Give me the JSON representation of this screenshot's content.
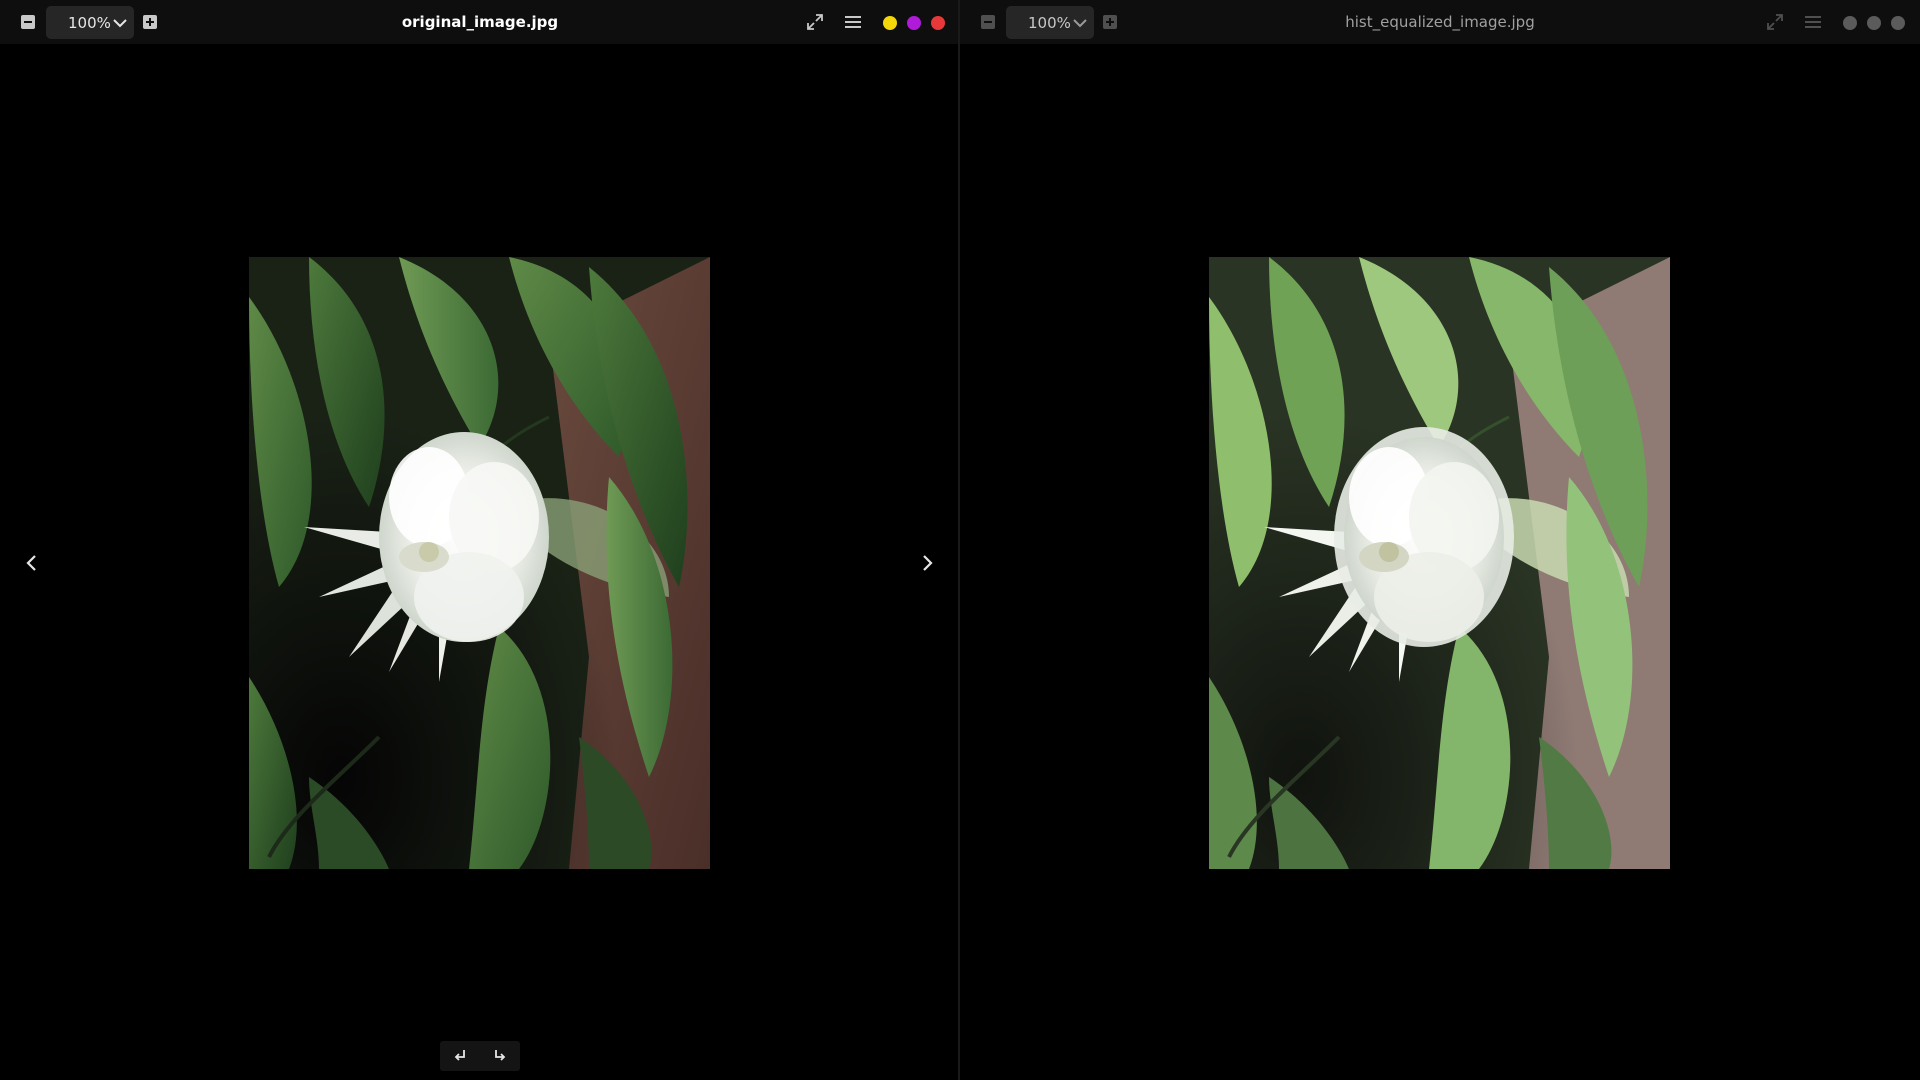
{
  "left": {
    "zoom": "100%",
    "title": "original_image.jpg",
    "window_dots": [
      "#f5d60a",
      "#b01ad9",
      "#e8393a"
    ]
  },
  "right": {
    "zoom": "100%",
    "title": "hist_equalized_image.jpg",
    "window_dots": [
      "#5b5b5b",
      "#5b5b5b",
      "#5b5b5b"
    ]
  },
  "icons": {
    "zoom_out": "minus-square-icon",
    "zoom_in": "plus-square-icon",
    "fullscreen": "expand-arrows-icon",
    "menu": "hamburger-menu-icon",
    "prev": "chevron-left-icon",
    "next": "chevron-right-icon",
    "rotate_left": "rotate-ccw-icon",
    "rotate_right": "rotate-cw-icon"
  },
  "colors": {
    "titlebar": "#0e0e0e",
    "background": "#000000",
    "zoom_box": "#262626",
    "title_active": "#ffffff",
    "title_inactive": "#a0a0a0"
  }
}
